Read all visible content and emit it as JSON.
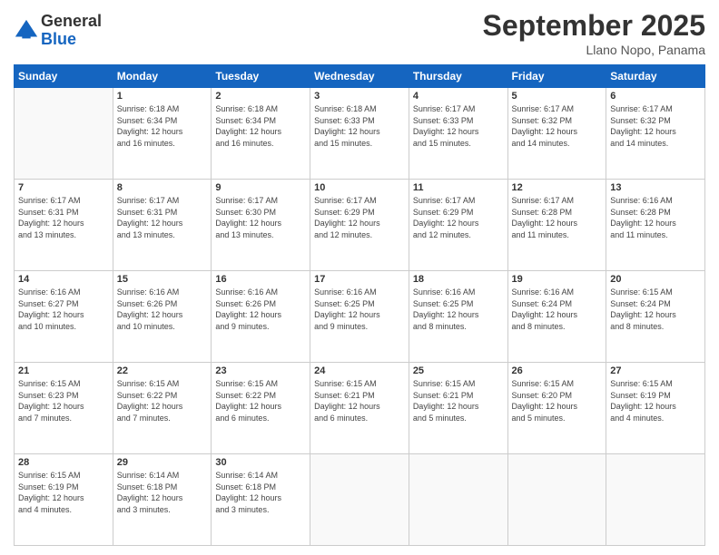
{
  "header": {
    "logo_line1": "General",
    "logo_line2": "Blue",
    "month": "September 2025",
    "location": "Llano Nopo, Panama"
  },
  "weekdays": [
    "Sunday",
    "Monday",
    "Tuesday",
    "Wednesday",
    "Thursday",
    "Friday",
    "Saturday"
  ],
  "weeks": [
    [
      {
        "day": "",
        "info": ""
      },
      {
        "day": "1",
        "info": "Sunrise: 6:18 AM\nSunset: 6:34 PM\nDaylight: 12 hours\nand 16 minutes."
      },
      {
        "day": "2",
        "info": "Sunrise: 6:18 AM\nSunset: 6:34 PM\nDaylight: 12 hours\nand 16 minutes."
      },
      {
        "day": "3",
        "info": "Sunrise: 6:18 AM\nSunset: 6:33 PM\nDaylight: 12 hours\nand 15 minutes."
      },
      {
        "day": "4",
        "info": "Sunrise: 6:17 AM\nSunset: 6:33 PM\nDaylight: 12 hours\nand 15 minutes."
      },
      {
        "day": "5",
        "info": "Sunrise: 6:17 AM\nSunset: 6:32 PM\nDaylight: 12 hours\nand 14 minutes."
      },
      {
        "day": "6",
        "info": "Sunrise: 6:17 AM\nSunset: 6:32 PM\nDaylight: 12 hours\nand 14 minutes."
      }
    ],
    [
      {
        "day": "7",
        "info": "Sunrise: 6:17 AM\nSunset: 6:31 PM\nDaylight: 12 hours\nand 13 minutes."
      },
      {
        "day": "8",
        "info": "Sunrise: 6:17 AM\nSunset: 6:31 PM\nDaylight: 12 hours\nand 13 minutes."
      },
      {
        "day": "9",
        "info": "Sunrise: 6:17 AM\nSunset: 6:30 PM\nDaylight: 12 hours\nand 13 minutes."
      },
      {
        "day": "10",
        "info": "Sunrise: 6:17 AM\nSunset: 6:29 PM\nDaylight: 12 hours\nand 12 minutes."
      },
      {
        "day": "11",
        "info": "Sunrise: 6:17 AM\nSunset: 6:29 PM\nDaylight: 12 hours\nand 12 minutes."
      },
      {
        "day": "12",
        "info": "Sunrise: 6:17 AM\nSunset: 6:28 PM\nDaylight: 12 hours\nand 11 minutes."
      },
      {
        "day": "13",
        "info": "Sunrise: 6:16 AM\nSunset: 6:28 PM\nDaylight: 12 hours\nand 11 minutes."
      }
    ],
    [
      {
        "day": "14",
        "info": "Sunrise: 6:16 AM\nSunset: 6:27 PM\nDaylight: 12 hours\nand 10 minutes."
      },
      {
        "day": "15",
        "info": "Sunrise: 6:16 AM\nSunset: 6:26 PM\nDaylight: 12 hours\nand 10 minutes."
      },
      {
        "day": "16",
        "info": "Sunrise: 6:16 AM\nSunset: 6:26 PM\nDaylight: 12 hours\nand 9 minutes."
      },
      {
        "day": "17",
        "info": "Sunrise: 6:16 AM\nSunset: 6:25 PM\nDaylight: 12 hours\nand 9 minutes."
      },
      {
        "day": "18",
        "info": "Sunrise: 6:16 AM\nSunset: 6:25 PM\nDaylight: 12 hours\nand 8 minutes."
      },
      {
        "day": "19",
        "info": "Sunrise: 6:16 AM\nSunset: 6:24 PM\nDaylight: 12 hours\nand 8 minutes."
      },
      {
        "day": "20",
        "info": "Sunrise: 6:15 AM\nSunset: 6:24 PM\nDaylight: 12 hours\nand 8 minutes."
      }
    ],
    [
      {
        "day": "21",
        "info": "Sunrise: 6:15 AM\nSunset: 6:23 PM\nDaylight: 12 hours\nand 7 minutes."
      },
      {
        "day": "22",
        "info": "Sunrise: 6:15 AM\nSunset: 6:22 PM\nDaylight: 12 hours\nand 7 minutes."
      },
      {
        "day": "23",
        "info": "Sunrise: 6:15 AM\nSunset: 6:22 PM\nDaylight: 12 hours\nand 6 minutes."
      },
      {
        "day": "24",
        "info": "Sunrise: 6:15 AM\nSunset: 6:21 PM\nDaylight: 12 hours\nand 6 minutes."
      },
      {
        "day": "25",
        "info": "Sunrise: 6:15 AM\nSunset: 6:21 PM\nDaylight: 12 hours\nand 5 minutes."
      },
      {
        "day": "26",
        "info": "Sunrise: 6:15 AM\nSunset: 6:20 PM\nDaylight: 12 hours\nand 5 minutes."
      },
      {
        "day": "27",
        "info": "Sunrise: 6:15 AM\nSunset: 6:19 PM\nDaylight: 12 hours\nand 4 minutes."
      }
    ],
    [
      {
        "day": "28",
        "info": "Sunrise: 6:15 AM\nSunset: 6:19 PM\nDaylight: 12 hours\nand 4 minutes."
      },
      {
        "day": "29",
        "info": "Sunrise: 6:14 AM\nSunset: 6:18 PM\nDaylight: 12 hours\nand 3 minutes."
      },
      {
        "day": "30",
        "info": "Sunrise: 6:14 AM\nSunset: 6:18 PM\nDaylight: 12 hours\nand 3 minutes."
      },
      {
        "day": "",
        "info": ""
      },
      {
        "day": "",
        "info": ""
      },
      {
        "day": "",
        "info": ""
      },
      {
        "day": "",
        "info": ""
      }
    ]
  ]
}
